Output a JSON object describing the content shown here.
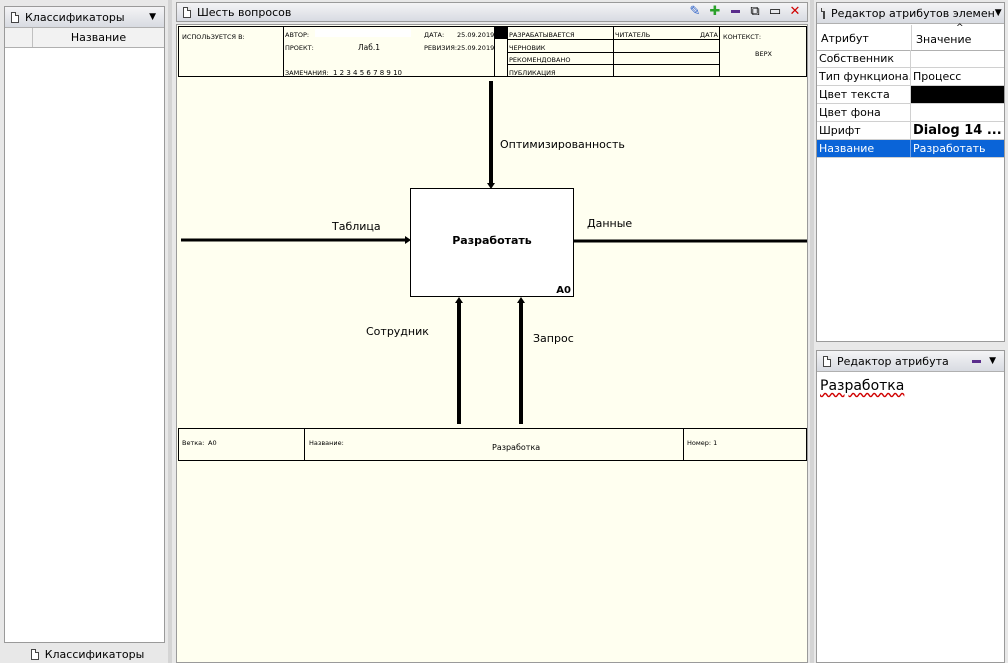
{
  "left_panel": {
    "title": "Классификаторы",
    "column_header": "Название",
    "bottom_tab": "Классификаторы"
  },
  "diagram_window": {
    "title": "Шесть вопросов"
  },
  "frame": {
    "used_in": "ИСПОЛЬЗУЕТСЯ В:",
    "author_label": "АВТОР:",
    "project_label": "ПРОЕКТ:",
    "project_value": "Лаб.1",
    "date_label": "ДАТА:",
    "date_value": "25.09.2019",
    "revision_label": "РЕВИЗИЯ:",
    "revision_value": "25.09.2019",
    "notes_label": "ЗАМЕЧАНИЯ:",
    "notes_numbers": "1  2  3  4  5  6  7  8  9  10",
    "status": [
      "РАЗРАБАТЫВАЕТСЯ",
      "ЧЕРНОВИК",
      "РЕКОМЕНДОВАНО",
      "ПУБЛИКАЦИЯ"
    ],
    "reader_label": "ЧИТАТЕЛЬ",
    "date_col_label": "ДАТА",
    "context_label": "КОНТЕКСТ:",
    "context_value": "ВЕРХ",
    "node_label": "Ветка:",
    "node_value": "A0",
    "title_label": "Название:",
    "title_value": "Разработка",
    "number_label": "Номер: 1"
  },
  "diagram": {
    "box_label": "Разработать",
    "box_id": "A0",
    "arrows": {
      "control": "Оптимизированность",
      "input": "Таблица",
      "output": "Данные",
      "mechanism1": "Сотрудник",
      "mechanism2": "Запрос"
    }
  },
  "attr_editor": {
    "title": "Редактор атрибутов элемен",
    "col_attr": "Атрибут",
    "col_value": "Значение",
    "rows": [
      {
        "attr": "Собственник",
        "value": ""
      },
      {
        "attr": "Тип функциона...",
        "value": "Процесс"
      },
      {
        "attr": "Цвет текста",
        "value": ""
      },
      {
        "attr": "Цвет фона",
        "value": ""
      },
      {
        "attr": "Шрифт",
        "value": "Dialog 14 ..."
      },
      {
        "attr": "Название",
        "value": "Разработать"
      }
    ],
    "text_color": "#000000",
    "selected_color": "#0a64d8"
  },
  "single_attr_editor": {
    "title": "Редактор атрибута",
    "value": "Разработка"
  }
}
